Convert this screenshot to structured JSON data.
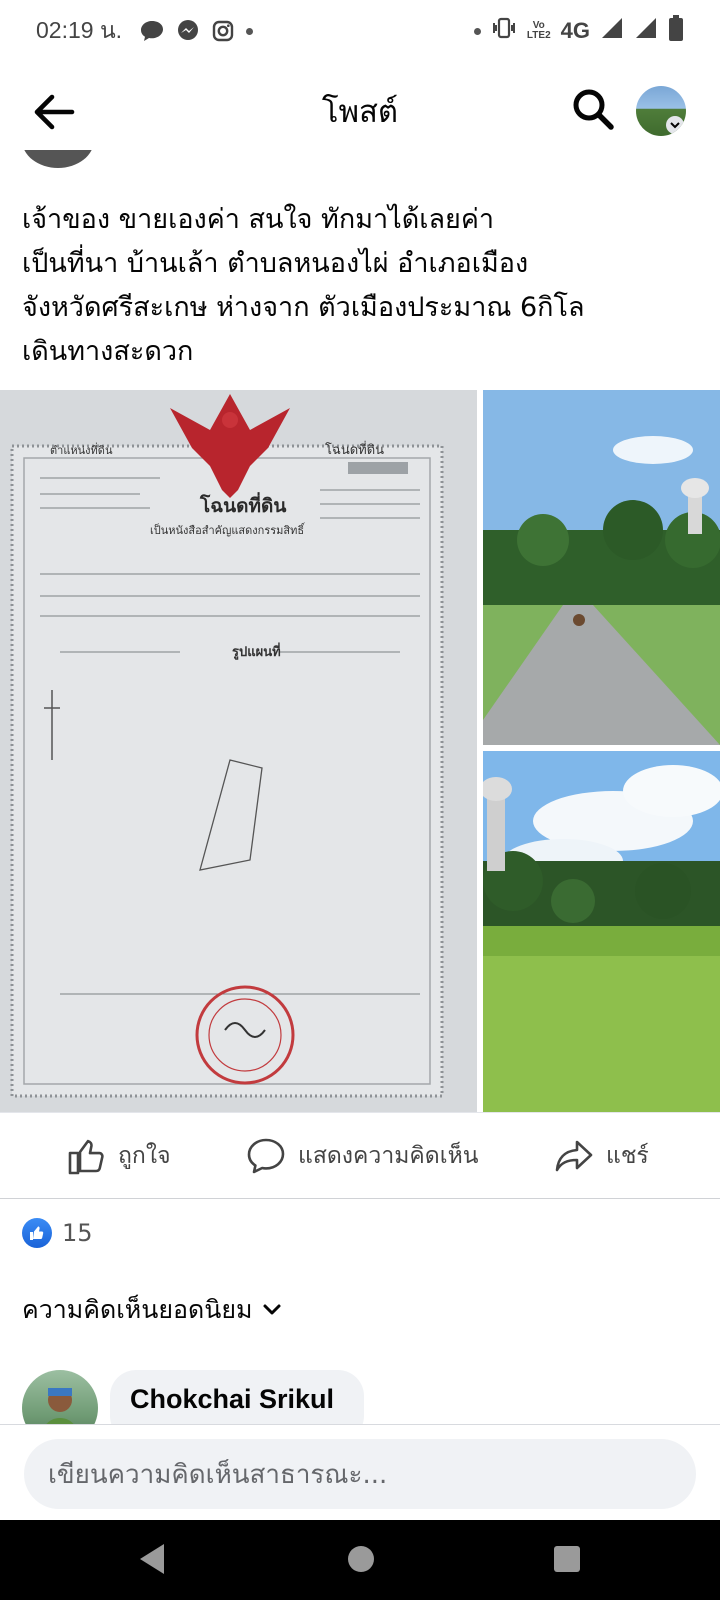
{
  "status_bar": {
    "time": "02:19 น.",
    "network": "4G",
    "volte": [
      "Vo",
      "LTE2"
    ],
    "icons": [
      "chat-bubble-icon",
      "messenger-icon",
      "instagram-icon",
      "dot-icon",
      "vibrate-icon",
      "volte-icon",
      "signal-icon",
      "signal-icon",
      "battery-icon"
    ]
  },
  "header": {
    "title": "โพสต์",
    "back_icon": "arrow-left-icon",
    "search_icon": "search-icon",
    "profile_icon": "chevron-down-icon"
  },
  "post": {
    "text_lines": [
      "เจ้าของ ขายเองค่า สนใจ ทักมาได้เลยค่า",
      "เป็นที่นา บ้านเล้า ตำบลหนองไผ่ อำเภอเมือง",
      "จังหวัดศรีสะเกษ ห่างจาก ตัวเมืองประมาณ 6กิโล",
      "เดินทางสะดวก"
    ],
    "deed": {
      "title": "โฉนดที่ดิน",
      "subtitle": "เป็นหนังสือสำคัญแสดงกรรมสิทธิ์",
      "heading_left": "ตำแหน่งที่ดิน",
      "heading_right": "โฉนดที่ดิน",
      "map_label": "รูปแผนที่"
    }
  },
  "actions": {
    "like_label": "ถูกใจ",
    "comment_label": "แสดงความคิดเห็น",
    "share_label": "แชร์"
  },
  "reactions": {
    "count": "15"
  },
  "comments": {
    "sort_label": "ความคิดเห็นยอดนิยม",
    "first_author": "Chokchai Srikul"
  },
  "composer": {
    "placeholder": "เขียนความคิดเห็นสาธารณะ..."
  }
}
